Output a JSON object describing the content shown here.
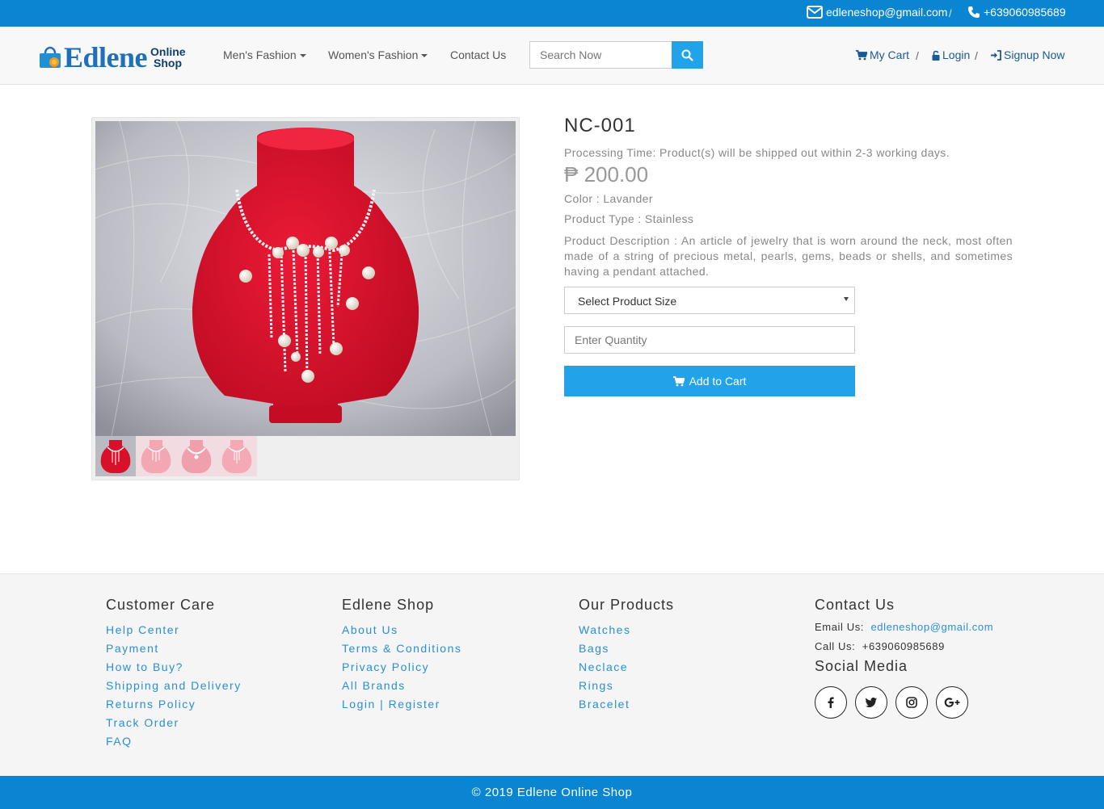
{
  "topbar": {
    "email": "edleneshop@gmail.com",
    "separator": "/",
    "phone": "+639060985689",
    "email_icon": "envelope-icon",
    "phone_icon": "phone-icon"
  },
  "nav": {
    "logo_word": "Edlene",
    "logo_sub_1": "Online",
    "logo_sub_2": "Shop",
    "mens": "Men's Fashion",
    "womens": "Women's Fashion",
    "contact": "Contact Us",
    "search_placeholder": "Search Now",
    "cart": "My Cart",
    "login": "Login",
    "signup": "Signup Now",
    "separator": "/"
  },
  "product": {
    "title": "NC-001",
    "processing": "Processing Time: Product(s) will be shipped out within 2-3 working days.",
    "price": "₱ 200.00",
    "color": "Color : Lavander",
    "type": "Product Type : Stainless",
    "description": "Product Description : An article of jewelry that is worn around the neck, most often made of a string of precious metal, pearls, gems, beads or shells, and sometimes having a pendant attached.",
    "size_select": "Select Product Size",
    "quantity_placeholder": "Enter Quantity",
    "add_to_cart": "Add to Cart"
  },
  "footer": {
    "care": {
      "heading": "Customer Care",
      "links": [
        "Help Center",
        "Payment",
        "How to Buy?",
        "Shipping and Delivery",
        "Returns Policy",
        "Track Order",
        "FAQ"
      ]
    },
    "shop": {
      "heading": "Edlene Shop",
      "links": [
        "About Us",
        "Terms & Conditions",
        "Privacy Policy",
        "All Brands",
        "Login | Register"
      ]
    },
    "products": {
      "heading": "Our Products",
      "links": [
        "Watches",
        "Bags",
        "Neclace",
        "Rings",
        "Bracelet"
      ]
    },
    "contact": {
      "heading": "Contact Us",
      "email_label": "Email Us:",
      "email": "edleneshop@gmail.com",
      "call_label": "Call Us:",
      "phone": "+639060985689",
      "social_heading": "Social Media",
      "socials": [
        "facebook-icon",
        "twitter-icon",
        "instagram-icon",
        "google-plus-icon"
      ]
    },
    "copyright": "© 2019 Edlene Online Shop"
  },
  "colors": {
    "brand_blue": "#0a85d1",
    "button_blue": "#22a3e9",
    "link_blue": "#2a8fd6",
    "stand_red": "#d8102a"
  }
}
